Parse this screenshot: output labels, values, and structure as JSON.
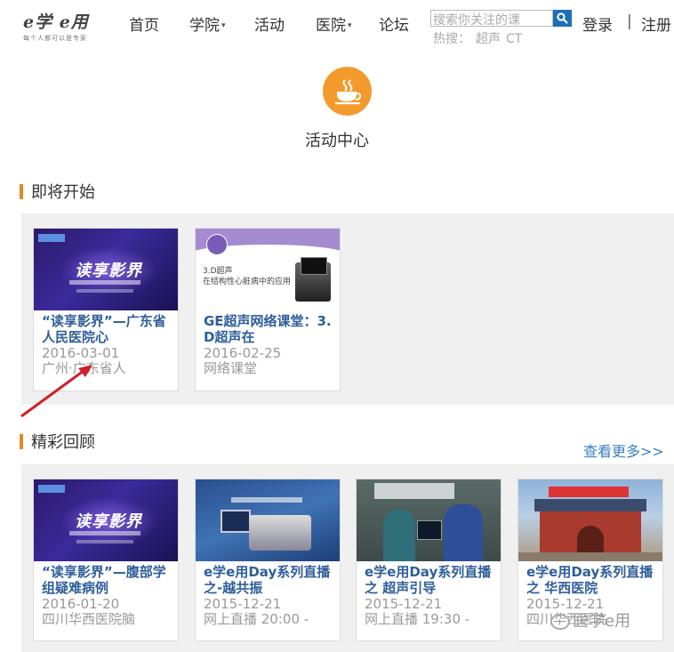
{
  "header": {
    "logo_text": "e学 e用",
    "logo_slogan": "每个人都可以是专家",
    "nav": [
      {
        "label": "首页",
        "has_menu": false
      },
      {
        "label": "学院",
        "has_menu": true
      },
      {
        "label": "活动",
        "has_menu": false
      },
      {
        "label": "医院",
        "has_menu": true
      },
      {
        "label": "论坛",
        "has_menu": false
      }
    ],
    "search_placeholder": "搜索你关注的课",
    "hot_label": "热搜：",
    "hot_terms": [
      "超声",
      "CT"
    ],
    "login": "登录",
    "separator": "|",
    "register": "注册"
  },
  "hero": {
    "icon": "coffee-cup-icon",
    "title": "活动中心"
  },
  "upcoming": {
    "title": "即将开始",
    "cards": [
      {
        "title": "“读享影界”—广东省人民医院心",
        "date": "2016-03-01",
        "place": "广州·广东省人",
        "thumb": "purple"
      },
      {
        "title": "GE超声网络课堂：3.D超声在",
        "date": "2016-02-25",
        "place": "网络课堂",
        "thumb": "ge"
      }
    ]
  },
  "review": {
    "title": "精彩回顾",
    "more": "查看更多>>",
    "cards": [
      {
        "title": "“读享影界”—腹部学组疑难病例",
        "date": "2016-01-20",
        "place": "四川华西医院脑",
        "thumb": "purple"
      },
      {
        "title": "e学e用Day系列直播之-越共振",
        "date": "2015-12-21",
        "place": "网上直播 20:00 -",
        "thumb": "blue"
      },
      {
        "title": "e学e用Day系列直播之 超声引导",
        "date": "2015-12-21",
        "place": "网上直播 19:30 -",
        "thumb": "room"
      },
      {
        "title": "e学e用Day系列直播之 华西医院",
        "date": "2015-12-21",
        "place": "四川华西医院",
        "thumb": "gate"
      }
    ]
  },
  "watermark": "医学e用",
  "colors": {
    "accent": "#f39a2c",
    "link": "#2e5e9a",
    "search_button": "#1f6fb7",
    "annotation_arrow": "#d0202a"
  }
}
